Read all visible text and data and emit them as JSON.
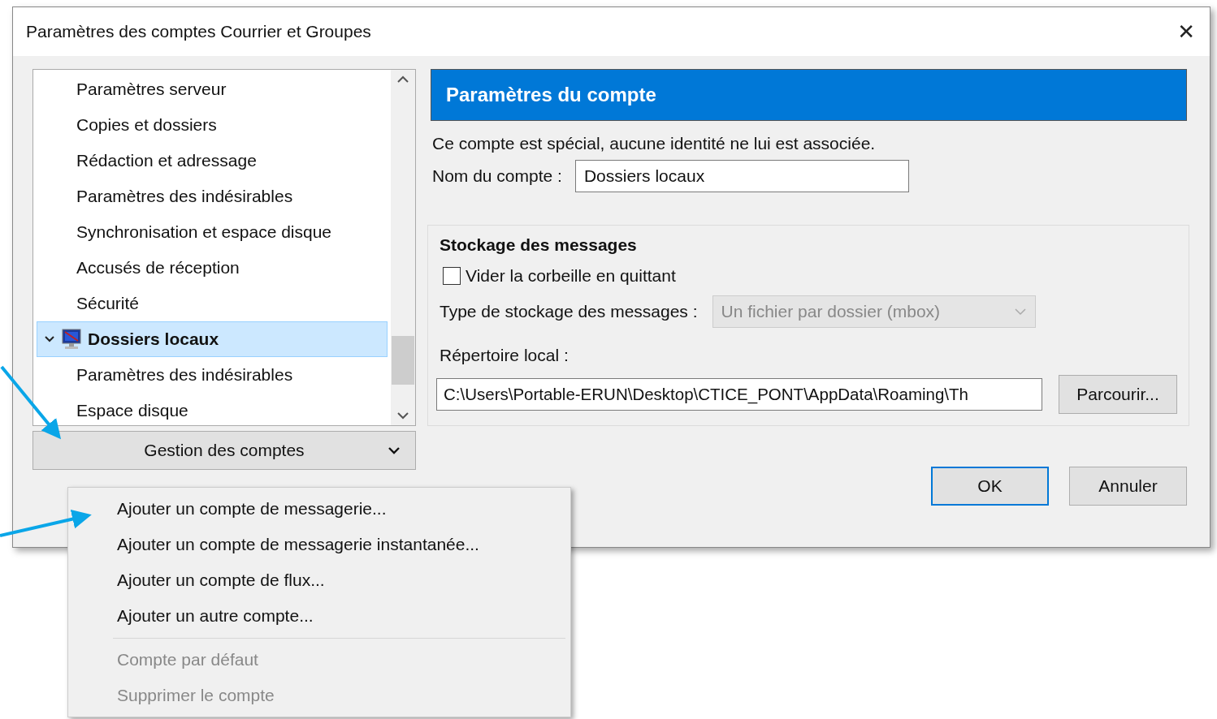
{
  "window": {
    "title": "Paramètres des comptes Courrier et Groupes",
    "close": "✕"
  },
  "tree": {
    "continued_children": [
      {
        "label": "Paramètres serveur",
        "selected": false
      },
      {
        "label": "Copies et dossiers",
        "selected": false
      },
      {
        "label": "Rédaction et adressage",
        "selected": false
      },
      {
        "label": "Paramètres des indésirables",
        "selected": false
      },
      {
        "label": "Synchronisation et espace disque",
        "selected": false
      },
      {
        "label": "Accusés de réception",
        "selected": false
      },
      {
        "label": "Sécurité",
        "selected": false
      }
    ],
    "nodes": [
      {
        "label": "Dossiers locaux",
        "selected": true,
        "expanded": true,
        "children": [
          {
            "label": "Paramètres des indésirables",
            "selected": false
          },
          {
            "label": "Espace disque",
            "selected": false
          }
        ]
      }
    ]
  },
  "account_actions_button": {
    "label": "Gestion des comptes"
  },
  "panel": {
    "header": "Paramètres du compte",
    "description": "Ce compte est spécial, aucune identité ne lui est associée.",
    "account_name": {
      "label": "Nom du compte :",
      "value": "Dossiers locaux"
    },
    "storage": {
      "title": "Stockage des messages",
      "empty_trash": {
        "label": "Vider la corbeille en quittant",
        "checked": false
      },
      "type": {
        "label": "Type de stockage des messages :",
        "value": "Un fichier par dossier (mbox)",
        "disabled": true
      },
      "local_dir": {
        "label": "Répertoire local :",
        "value": "C:\\Users\\Portable-ERUN\\Desktop\\CTICE_PONT\\AppData\\Roaming\\Th",
        "browse": "Parcourir..."
      }
    }
  },
  "buttons": [
    "OK",
    "Annuler"
  ],
  "menu": {
    "groups": [
      [
        {
          "label": "Ajouter un compte de messagerie...",
          "disabled": false
        },
        {
          "label": "Ajouter un compte de messagerie instantanée...",
          "disabled": false
        },
        {
          "label": "Ajouter un compte de flux...",
          "disabled": false
        },
        {
          "label": "Ajouter un autre compte...",
          "disabled": false
        }
      ],
      [
        {
          "label": "Compte par défaut",
          "disabled": true
        },
        {
          "label": "Supprimer le compte",
          "disabled": true
        }
      ]
    ]
  }
}
